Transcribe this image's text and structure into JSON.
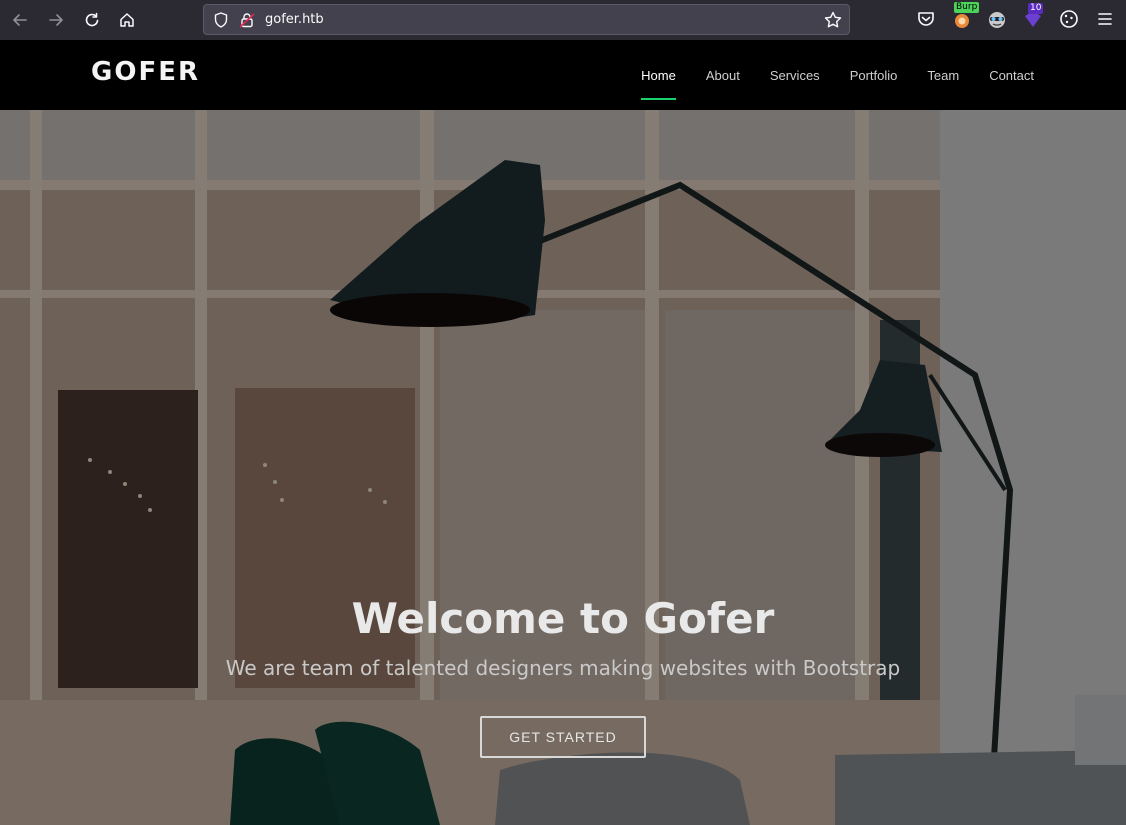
{
  "browser": {
    "url": "gofer.htb",
    "extensions": [
      {
        "name": "burp-extension",
        "badge": "Burp"
      },
      {
        "name": "privacy-extension",
        "badge": ""
      },
      {
        "name": "shield-extension",
        "badge": "10"
      }
    ]
  },
  "site": {
    "logo": "GOFER",
    "nav": [
      "Home",
      "About",
      "Services",
      "Portfolio",
      "Team",
      "Contact"
    ],
    "active_nav": "Home",
    "accent_color": "#18d26e"
  },
  "hero": {
    "title": "Welcome to Gofer",
    "subtitle": "We are team of talented designers making websites with Bootstrap",
    "button": "GET STARTED"
  }
}
